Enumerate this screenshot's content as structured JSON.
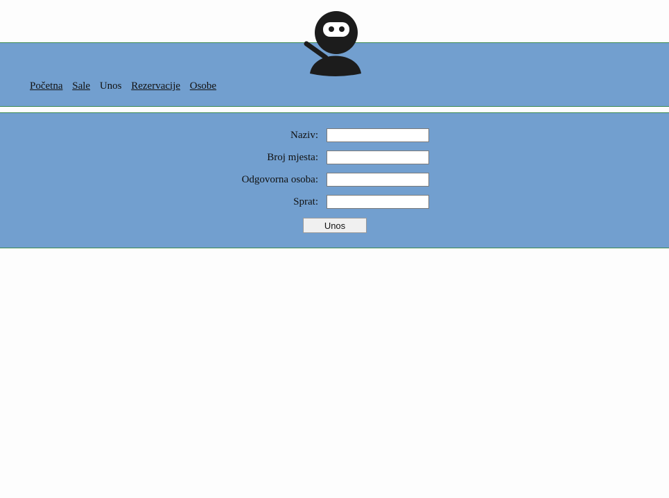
{
  "header": {
    "logo_icon": "ninja-icon",
    "colors": {
      "band": "#729fcf",
      "band_border": "#3d8a52",
      "logo": "#1c1c1c"
    }
  },
  "nav": {
    "items": [
      {
        "label": "Početna",
        "link": true
      },
      {
        "label": "Sale",
        "link": true
      },
      {
        "label": "Unos",
        "link": false
      },
      {
        "label": "Rezervacije",
        "link": true
      },
      {
        "label": "Osobe",
        "link": true
      }
    ]
  },
  "form": {
    "fields": [
      {
        "label": "Naziv:",
        "value": ""
      },
      {
        "label": "Broj mjesta:",
        "value": ""
      },
      {
        "label": "Odgovorna osoba:",
        "value": ""
      },
      {
        "label": "Sprat:",
        "value": ""
      }
    ],
    "submit_label": "Unos"
  }
}
